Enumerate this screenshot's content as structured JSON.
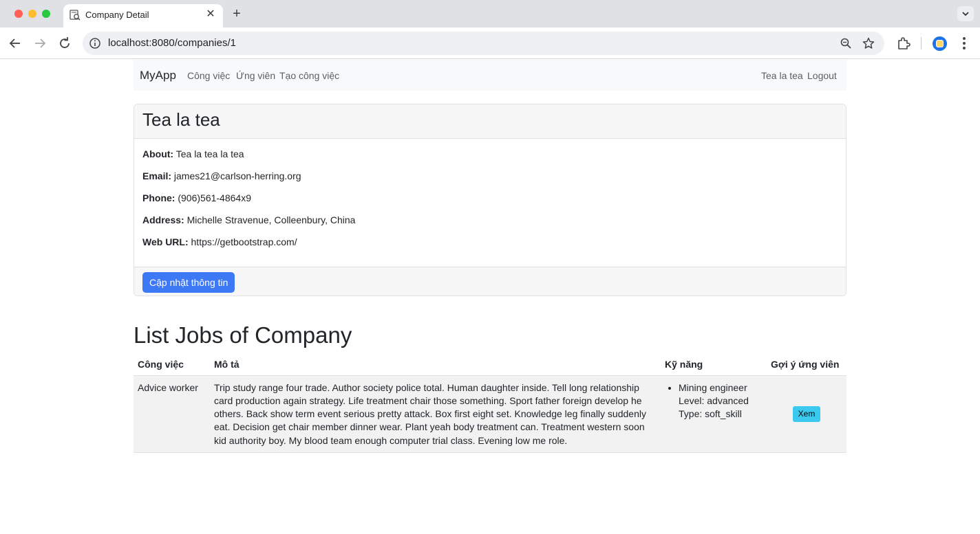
{
  "browser": {
    "tab_title": "Company Detail",
    "url": "localhost:8080/companies/1"
  },
  "navbar": {
    "brand": "MyApp",
    "links": [
      "Công việc",
      "Ứng viên",
      "Tạo công việc"
    ],
    "user_name": "Tea la tea",
    "logout": "Logout"
  },
  "company": {
    "name": "Tea la tea",
    "fields": [
      {
        "label": "About:",
        "value": "Tea la tea la tea"
      },
      {
        "label": "Email:",
        "value": "james21@carlson-herring.org"
      },
      {
        "label": "Phone:",
        "value": "(906)561-4864x9"
      },
      {
        "label": "Address:",
        "value": "Michelle Stravenue, Colleenbury, China"
      },
      {
        "label": "Web URL:",
        "value": "https://getbootstrap.com/"
      }
    ],
    "update_button": "Cập nhật thông tin"
  },
  "jobs": {
    "title": "List Jobs of Company",
    "columns": [
      "Công việc",
      "Mô tả",
      "Kỹ năng",
      "Gợi ý ứng viên"
    ],
    "rows": [
      {
        "name": "Advice worker",
        "description": "Trip study range four trade. Author society police total. Human daughter inside. Tell long relationship card production again strategy. Life treatment chair those something. Sport father foreign develop he others. Back show term event serious pretty attack. Box first eight set. Knowledge leg finally suddenly eat. Decision get chair member dinner wear. Plant yeah body treatment can. Treatment western soon kid authority boy. My blood team enough computer trial class. Evening low me role.",
        "skills": [
          {
            "name": "Mining engineer",
            "level": "Level: advanced",
            "type": "Type: soft_skill"
          }
        ],
        "action": "Xem"
      }
    ]
  }
}
